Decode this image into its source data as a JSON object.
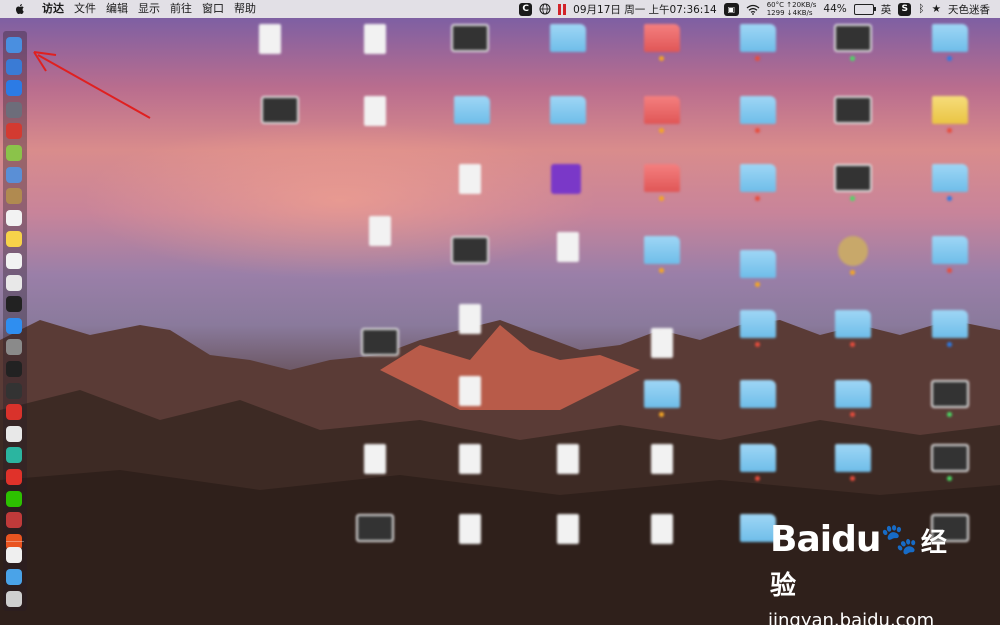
{
  "menubar": {
    "app_name": "访达",
    "menus": [
      "文件",
      "编辑",
      "显示",
      "前往",
      "窗口",
      "帮助"
    ],
    "datetime": "09月17日 周一 上午07:36:14",
    "temperature": "60°C",
    "upload_speed": "↑20KB/s",
    "cpu_speed": "1299",
    "download_speed": "↓4KB/s",
    "battery": "44%",
    "input_method": "英",
    "user": "天色迷香"
  },
  "dock": {
    "icons": [
      {
        "name": "finder-icon",
        "color": "#4a8fe0"
      },
      {
        "name": "chrome-icon",
        "color": "#3a7bd5"
      },
      {
        "name": "safari-icon",
        "color": "#2c7be5"
      },
      {
        "name": "launchpad-icon",
        "color": "#6d6d7a"
      },
      {
        "name": "netease-music-icon",
        "color": "#d33a31"
      },
      {
        "name": "android-icon",
        "color": "#8bc34a"
      },
      {
        "name": "preview-icon",
        "color": "#5a8fd6"
      },
      {
        "name": "archive-icon",
        "color": "#b08a50"
      },
      {
        "name": "calendar-icon",
        "color": "#f2f2f2"
      },
      {
        "name": "notes-icon",
        "color": "#f7d34a"
      },
      {
        "name": "reminders-icon",
        "color": "#f2f2f2"
      },
      {
        "name": "photos-icon",
        "color": "#e8e8e8"
      },
      {
        "name": "terminal-icon",
        "color": "#222222"
      },
      {
        "name": "app-store-icon",
        "color": "#2f8ef0"
      },
      {
        "name": "system-preferences-icon",
        "color": "#8a8a8a"
      },
      {
        "name": "activity-monitor-icon",
        "color": "#222222"
      },
      {
        "name": "console-icon",
        "color": "#333333"
      },
      {
        "name": "vivaldi-icon",
        "color": "#d9322b"
      },
      {
        "name": "yandex-icon",
        "color": "#e8e8e8"
      },
      {
        "name": "app-green-icon",
        "color": "#2bb5a0"
      },
      {
        "name": "weibo-icon",
        "color": "#e0322a"
      },
      {
        "name": "wechat-icon",
        "color": "#2dc100"
      },
      {
        "name": "xcode-icon",
        "color": "#c03a3a"
      },
      {
        "name": "ubuntu-icon",
        "color": "#e95420"
      }
    ],
    "trailing_icons": [
      {
        "name": "document-icon",
        "color": "#efefef"
      },
      {
        "name": "downloads-folder-icon",
        "color": "#4aa3e8"
      },
      {
        "name": "trash-icon",
        "color": "#cfcfcf"
      }
    ]
  },
  "watermark": {
    "brand": "Baidu",
    "brand_cn": "经验",
    "url": "jingyan.baidu.com"
  }
}
